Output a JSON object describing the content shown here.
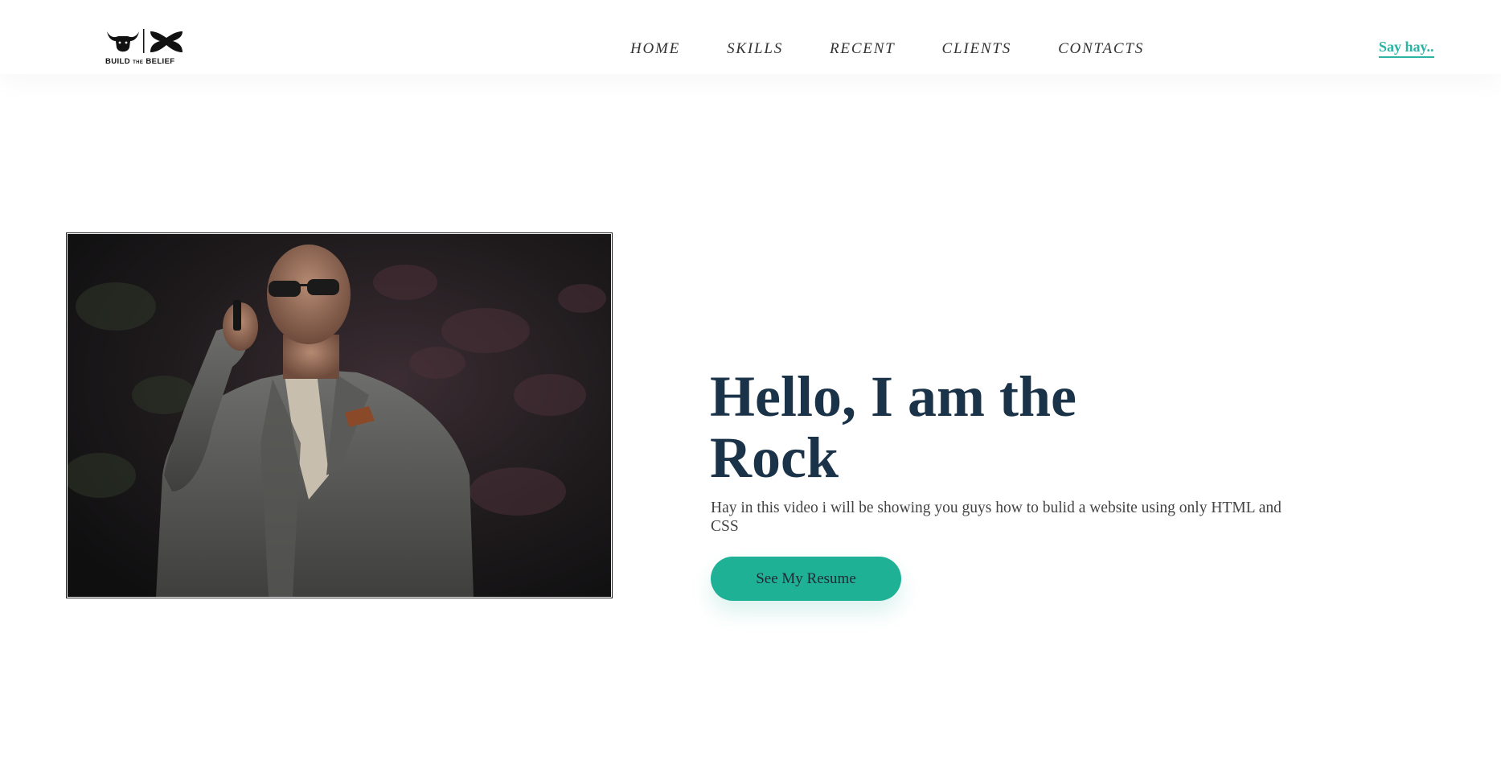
{
  "header": {
    "logo": {
      "caption_left": "BUILD",
      "caption_mid": "THE",
      "caption_right": "BELIEF"
    },
    "nav": [
      {
        "label": "HOME"
      },
      {
        "label": "SKILLS"
      },
      {
        "label": "RECENT"
      },
      {
        "label": "CLIENTS"
      },
      {
        "label": "CONTACTS"
      }
    ],
    "cta_link": "Say hay.."
  },
  "hero": {
    "title_line1": "Hello, I am the",
    "title_line2": "Rock",
    "description": "Hay in this video i will be showing you guys how to bulid a website using only HTML and CSS",
    "button_label": "See My Resume"
  },
  "colors": {
    "accent": "#1fb196",
    "link": "#2bb3a3",
    "heading": "#1b3349",
    "body_text": "#444444"
  },
  "icons": {
    "logo_bull": "bull-head-icon",
    "logo_brand": "brand-mark-icon"
  }
}
